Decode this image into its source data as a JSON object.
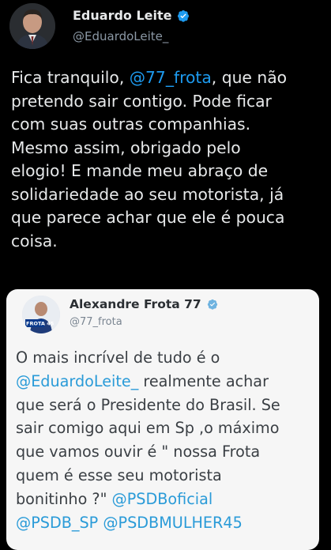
{
  "tweet": {
    "author_name": "Eduardo Leite",
    "author_handle": "@EduardoLeite_",
    "text_before": "Fica tranquilo, ",
    "mention": "@77_frota",
    "text_after": ", que não\npretendo sair contigo. Pode ficar\ncom suas outras companhias.\nMesmo assim, obrigado pelo\nelogio! E mande meu abraço de\nsolidariedade ao seu motorista, já\nque parece achar que ele é pouca\ncoisa."
  },
  "quoted": {
    "author_name": "Alexandre Frota 77",
    "author_handle": "@77_frota",
    "avatar_badge": "FROTA 45",
    "text_1": "O mais incrível de tudo é o\n",
    "mention_1": "@EduardoLeite_",
    "text_2": "  realmente achar\nque será o Presidente do Brasil. Se\nsair comigo aqui em Sp ,o máximo\nque vamos ouvir é \" nossa Frota\nquem é esse seu motorista\nbonitinho ?\" ",
    "mention_2": "@PSDBoficial",
    "mention_3": "@PSDB_SP",
    "mention_4": "@PSDBMULHER45"
  },
  "colors": {
    "background": "#000000",
    "link": "#1d9bf0",
    "verified": "#1d9bf0",
    "quote_background": "#f6f6f6"
  },
  "icons": {
    "verified": "verified-badge-icon"
  }
}
